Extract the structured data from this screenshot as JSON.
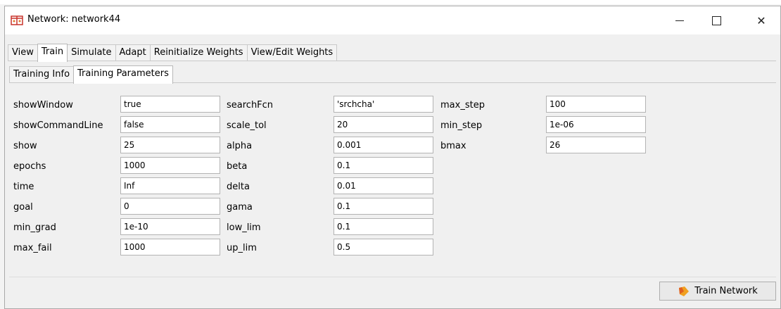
{
  "window": {
    "title": "Network: network44",
    "icon": "network-icon"
  },
  "tabs": [
    "View",
    "Train",
    "Simulate",
    "Adapt",
    "Reinitialize Weights",
    "View/Edit Weights"
  ],
  "active_tab": "Train",
  "subtabs": [
    "Training Info",
    "Training Parameters"
  ],
  "active_subtab": "Training Parameters",
  "params": {
    "col1": [
      {
        "name": "showWindow",
        "value": "true"
      },
      {
        "name": "showCommandLine",
        "value": "false"
      },
      {
        "name": "show",
        "value": "25"
      },
      {
        "name": "epochs",
        "value": "1000"
      },
      {
        "name": "time",
        "value": "Inf"
      },
      {
        "name": "goal",
        "value": "0"
      },
      {
        "name": "min_grad",
        "value": "1e-10"
      },
      {
        "name": "max_fail",
        "value": "1000"
      }
    ],
    "col2": [
      {
        "name": "searchFcn",
        "value": "'srchcha'"
      },
      {
        "name": "scale_tol",
        "value": "20"
      },
      {
        "name": "alpha",
        "value": "0.001"
      },
      {
        "name": "beta",
        "value": "0.1"
      },
      {
        "name": "delta",
        "value": "0.01"
      },
      {
        "name": "gama",
        "value": "0.1"
      },
      {
        "name": "low_lim",
        "value": "0.1"
      },
      {
        "name": "up_lim",
        "value": "0.5"
      }
    ],
    "col3": [
      {
        "name": "max_step",
        "value": "100"
      },
      {
        "name": "min_step",
        "value": "1e-06"
      },
      {
        "name": "bmax",
        "value": "26"
      }
    ]
  },
  "train_button": {
    "label": "Train Network",
    "icon": "train-icon"
  }
}
